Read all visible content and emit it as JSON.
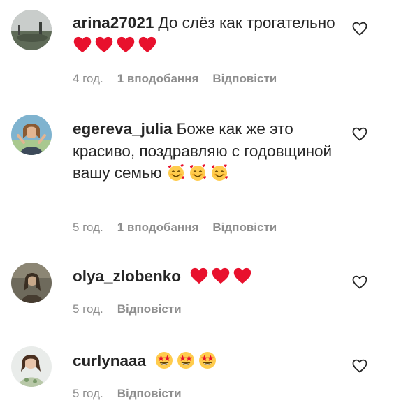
{
  "comments": [
    {
      "username": "arina27021",
      "text": "До слёз как трогательно",
      "emojis": [
        "red-heart",
        "red-heart",
        "red-heart",
        "red-heart"
      ],
      "time": "4 год.",
      "likes": "1 вподобання",
      "reply": "Відповісти"
    },
    {
      "username": "egereva_julia",
      "text": "Боже как же это красиво, поздравляю с годовщиной вашу семью",
      "emojis": [
        "smiling-face-with-hearts",
        "smiling-face-with-hearts",
        "smiling-face-with-hearts"
      ],
      "time": "5 год.",
      "likes": "1 вподобання",
      "reply": "Відповісти"
    },
    {
      "username": "olya_zlobenko",
      "text": "",
      "emojis": [
        "red-heart",
        "red-heart",
        "red-heart"
      ],
      "time": "5 год.",
      "likes": "",
      "reply": "Відповісти"
    },
    {
      "username": "curlynaaa",
      "text": "",
      "emojis": [
        "star-struck",
        "star-struck",
        "star-struck"
      ],
      "time": "5 год.",
      "likes": "",
      "reply": "Відповісти"
    }
  ],
  "colors": {
    "text": "#262626",
    "secondary": "#8e8e8e",
    "heart": "#e8112d",
    "emoji_face": "#ffcc4d"
  },
  "icons": {
    "like": "heart-outline-icon"
  }
}
